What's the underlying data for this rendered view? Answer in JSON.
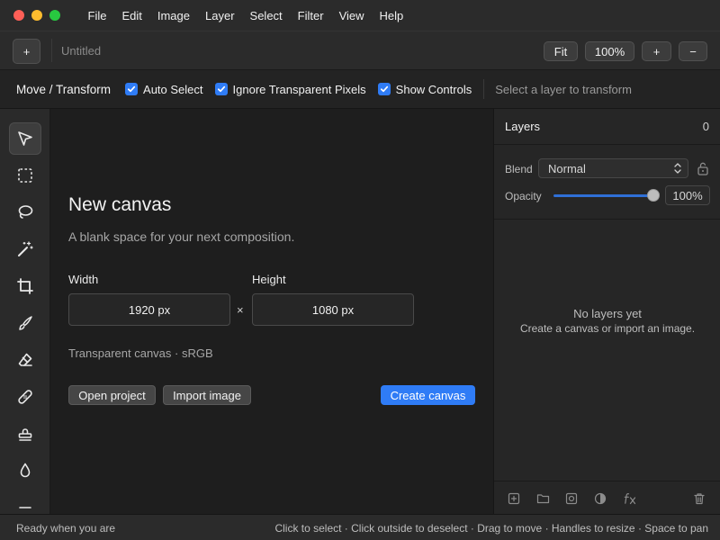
{
  "menubar": {
    "items": [
      "File",
      "Edit",
      "Image",
      "Layer",
      "Select",
      "Filter",
      "View",
      "Help"
    ],
    "traffic_colors": [
      "#ff5f57",
      "#febc2e",
      "#28c840"
    ]
  },
  "docbar": {
    "new_label": "+",
    "title": "Untitled",
    "fit_label": "Fit",
    "zoom_label": "100%",
    "zoom_in_label": "+",
    "zoom_out_label": "−"
  },
  "options": {
    "tool_name": "Move / Transform",
    "auto_select": "Auto Select",
    "ignore_transparent": "Ignore Transparent Pixels",
    "show_controls": "Show Controls",
    "hint": "Select a layer to transform"
  },
  "tools": [
    "move-tool-icon",
    "marquee-tool-icon",
    "lasso-tool-icon",
    "magic-wand-icon",
    "crop-tool-icon",
    "brush-tool-icon",
    "eraser-tool-icon",
    "healing-tool-icon",
    "stamp-tool-icon",
    "blur-tool-icon"
  ],
  "new_canvas": {
    "title": "New canvas",
    "subtitle": "A blank space for your next composition.",
    "width_label": "Width",
    "width_value": "1920 px",
    "times": "×",
    "height_label": "Height",
    "height_value": "1080 px",
    "meta": "Transparent canvas · sRGB",
    "open_label": "Open project",
    "import_label": "Import image",
    "create_label": "Create canvas",
    "accent": "#2f7cf6"
  },
  "layers": {
    "title": "Layers",
    "count": "0",
    "blend_label": "Blend",
    "blend_value": "Normal",
    "opacity_label": "Opacity",
    "opacity_value": "100%",
    "opacity_fraction": 1.0,
    "empty_title": "No layers yet",
    "empty_sub": "Create a canvas or import an image."
  },
  "status": {
    "left": "Ready when you are",
    "right": "Click to select · Click outside to deselect · Drag to move · Handles to resize · Space to pan"
  }
}
